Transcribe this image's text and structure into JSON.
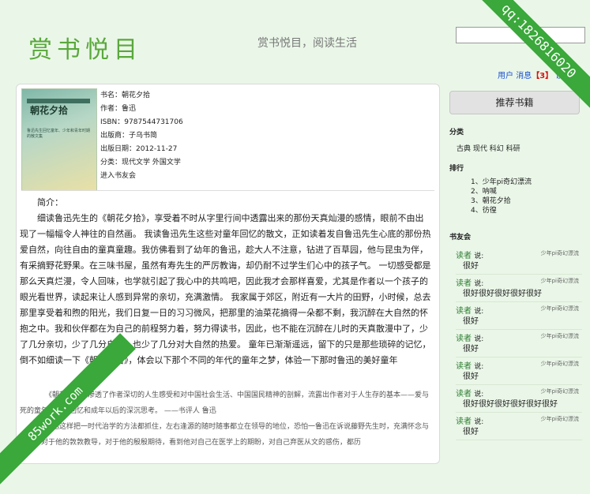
{
  "header": {
    "logo": "赏书悦目",
    "tagline": "赏书悦目，阅读生活",
    "search_placeholder": "",
    "user_link": "用户",
    "message_link": "消息",
    "message_count": "【3】",
    "settings_link": "设"
  },
  "book": {
    "cover_title": "朝花夕拾",
    "cover_subtitle": "鲁迅先生回忆童年、少年和青年时期的散文集",
    "title": "书名：朝花夕拾",
    "author": "作者：鲁迅",
    "isbn": "ISBN：9787544731706",
    "publisher": "出版商：子乌书简",
    "publish_date": "出版日期：2012-11-27",
    "category": "分类：现代文学 外国文学",
    "club_link": "进入书友会",
    "intro_label": "简介：",
    "intro": "细读鲁迅先生的《朝花夕拾》，享受着不时从字里行间中透露出来的那份天真灿漫的感情，眼前不由出现了一幅幅令人神往的自然画。 我读鲁迅先生这些对童年回忆的散文，正如读着发自鲁迅先生心底的那份热爱自然，向往自由的童真童趣。我仿佛看到了幼年的鲁迅，趁大人不注意，钻进了百草园，他与昆虫为伴，有采摘野花野果。在三味书屋，虽然有寿先生的严厉教诲，却仍耐不过学生们心中的孩子气。 一切感受都是那么天真烂漫，令人回味，也学就引起了我心中的共鸣吧，因此我才会那样喜爱，尤其是作者以一个孩子的眼光看世界，读起来让人感到异常的亲切，充满激情。 我家属于郊区，附近有一大片的田野，小时候，总去那里享受着和煦的阳光，我们日复一日的习习微风，把那里的油菜花摘得一朵都不剩，我沉醉在大自然的怀抱之中。我和伙伴都在为自己的前程努力着，努力得读书，因此，也不能在沉醉在儿时的天真散漫中了，少了几分亲切，少了几分自由，也少了几分对大自然的热爱。 童年已渐渐遥远，留下的只是那些琐碎的记忆，倒不如细读一下《朝花夕拾》，体会以下那个不同的年代的童年之梦，体验一下那时鲁迅的美好童年",
    "quote1": "《朝花夕拾》渗透了作者深切的人生感受和对中国社会生活、中国国民精神的剖解，流露出作者对于人生存的基本——爱与死的童年体验和回忆和成年以后的深沉思考。 ——书评人 鲁迅",
    "quote2": "鲁迅这样把一时代治学的方法都抓住，左右逢源的随时随事都立在领导的地位，恐怕一鲁迅在诉说藤野先生时，充满怀念与感激，对于他的敦敦教导，对于他的殷殷期待，看到他对自己在医学上的期盼，对自己弃医从文的惑伤，都历"
  },
  "sidebar": {
    "recommend_button": "推荐书籍",
    "categories_heading": "分类",
    "categories": "古典 现代 科幻 科研",
    "ranking_heading": "排行",
    "ranking": [
      "1、少年pi奇幻漂流",
      "2、呐喊",
      "3、朝花夕拾",
      "4、彷徨"
    ],
    "club_heading": "书友会",
    "posts": [
      {
        "user": "读者",
        "says": "说:",
        "book": "少年pi奇幻漂流",
        "text": "很好"
      },
      {
        "user": "读者",
        "says": "说:",
        "book": "少年pi奇幻漂流",
        "text": "很好很好很好很好很好"
      },
      {
        "user": "读者",
        "says": "说:",
        "book": "少年pi奇幻漂流",
        "text": "很好"
      },
      {
        "user": "读者",
        "says": "说:",
        "book": "少年pi奇幻漂流",
        "text": "很好"
      },
      {
        "user": "读者",
        "says": "说:",
        "book": "少年pi奇幻漂流",
        "text": "很好"
      },
      {
        "user": "读者",
        "says": "说:",
        "book": "少年pi奇幻漂流",
        "text": "很好很好很好很好很好很好"
      },
      {
        "user": "读者",
        "says": "说:",
        "book": "少年pi奇幻漂流",
        "text": "很好"
      }
    ]
  },
  "watermarks": {
    "top_right": "qq:1826816020",
    "bottom_left": "85work.com"
  }
}
